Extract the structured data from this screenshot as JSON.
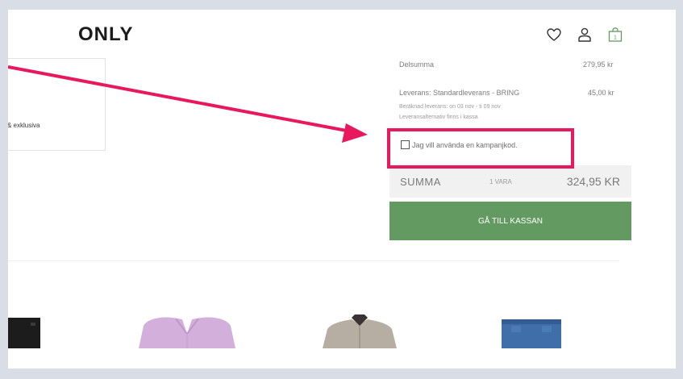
{
  "header": {
    "logo": "ONLY",
    "cart_count": "1"
  },
  "left_card": {
    "text": "& exklusiva"
  },
  "summary": {
    "subtotal_label": "Delsumma",
    "subtotal_value": "279,95 kr",
    "shipping_label": "Leverans: Standardleverans - BRING",
    "shipping_value": "45,00 kr",
    "delivery_estimate": "Beräknad leverans: on 03 nov - ti 09 nov",
    "delivery_alternatives": "Leveransalternativ finns i kassa",
    "promo_label": "Jag vill använda en kampanjkod.",
    "total_label": "SUMMA",
    "item_count": "1 VARA",
    "total_value": "324,95 KR",
    "checkout_label": "GÅ TILL KASSAN"
  },
  "colors": {
    "checkout_green": "#629a62",
    "annotation_pink": "#e8185d",
    "background": "#d9dde6"
  },
  "icons": [
    "heart-icon",
    "user-icon",
    "shopping-bag-icon"
  ]
}
